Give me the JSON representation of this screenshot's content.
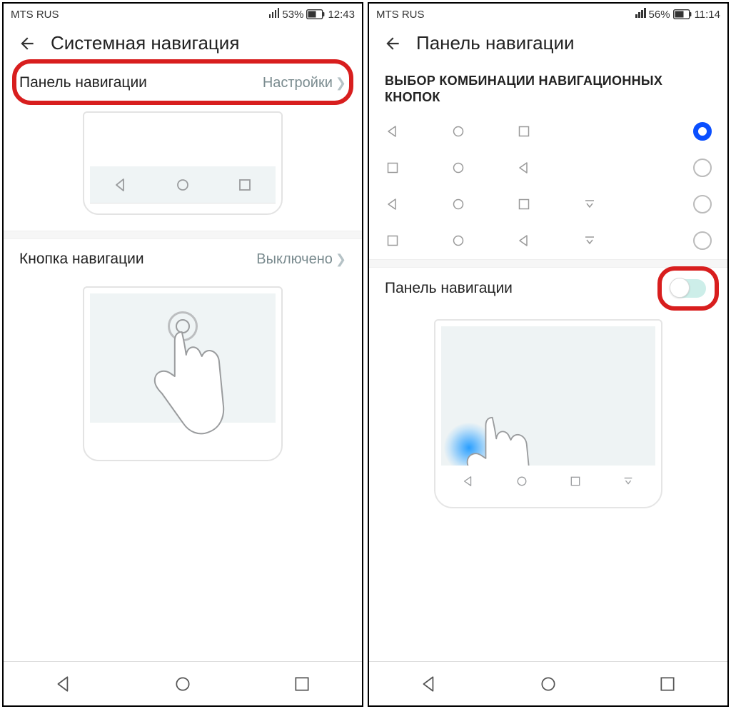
{
  "left": {
    "status": {
      "carrier": "MTS RUS",
      "battery": "53%",
      "time": "12:43"
    },
    "title": "Системная навигация",
    "row1": {
      "label": "Панель навигации",
      "value": "Настройки"
    },
    "row2": {
      "label": "Кнопка навигации",
      "value": "Выключено"
    }
  },
  "right": {
    "status": {
      "carrier": "MTS RUS",
      "battery": "56%",
      "time": "11:14"
    },
    "title": "Панель навигации",
    "section": "ВЫБОР КОМБИНАЦИИ НАВИГАЦИОННЫХ КНОПОК",
    "toggle_label": "Панель навигации"
  }
}
